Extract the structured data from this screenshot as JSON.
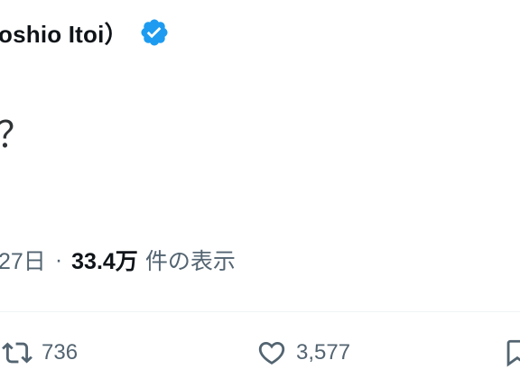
{
  "author": {
    "display_name_fragment": "oshio Itoi）",
    "verified": true,
    "badge_color": "#1d9bf0"
  },
  "tweet": {
    "text_fragment": "？"
  },
  "meta": {
    "date_fragment": "27日",
    "separator": "·",
    "views_count": "33.4万",
    "views_label": "件の表示"
  },
  "actions": {
    "retweet_count": "736",
    "like_count": "3,577",
    "bookmark_icon": "bookmark-icon",
    "retweet_icon": "retweet-icon",
    "like_icon": "heart-icon"
  },
  "colors": {
    "text_primary": "#0f1419",
    "text_secondary": "#536471",
    "divider": "#eff3f4"
  }
}
